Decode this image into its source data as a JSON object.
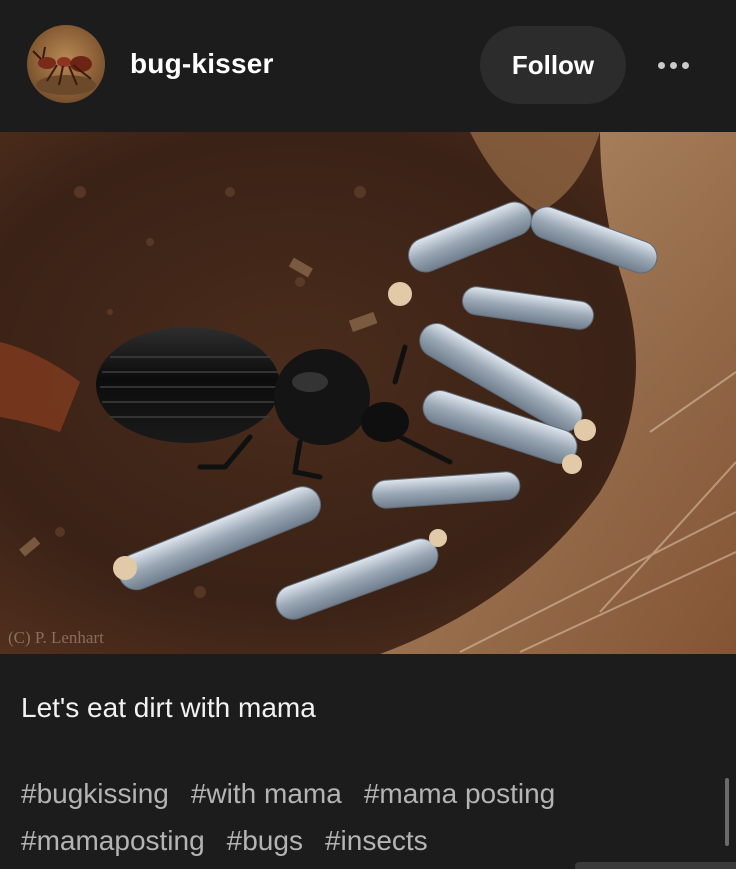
{
  "post": {
    "author": {
      "username": "bug-kisser",
      "avatar_icon": "ant-avatar-icon"
    },
    "follow_label": "Follow",
    "more_icon": "ellipsis-icon",
    "image": {
      "watermark": "(C) P. Lenhart"
    },
    "caption": "Let's eat dirt with mama",
    "tags": [
      "#bugkissing",
      "#with mama",
      "#mama posting",
      "#mamaposting",
      "#bugs",
      "#insects"
    ]
  },
  "colors": {
    "background": "#1c1c1c",
    "follow_button": "#2c2c2c",
    "tag_text": "#b4b4b4"
  }
}
